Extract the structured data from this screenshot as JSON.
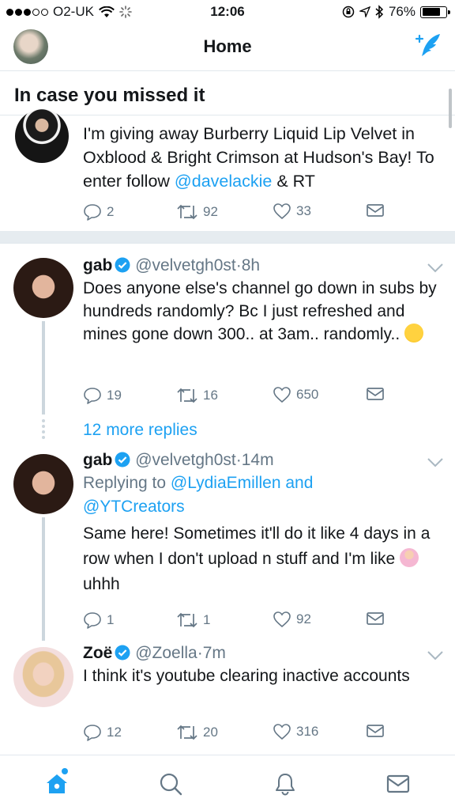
{
  "status_bar": {
    "carrier": "O2-UK",
    "time": "12:06",
    "battery": "76%",
    "battery_level": 0.76
  },
  "nav": {
    "title": "Home"
  },
  "section": {
    "title": "In case you missed it"
  },
  "tweets": [
    {
      "text_before": "I'm giving away Burberry Liquid Lip Velvet in Oxblood & Bright Crimson at Hudson's Bay! To enter follow ",
      "mention": "@davelackie",
      "text_after": " & RT",
      "replies": "2",
      "retweets": "92",
      "likes": "33"
    },
    {
      "name": "gab",
      "handle": "@velvetgh0st",
      "time": "8h",
      "text": "Does anyone else's channel go down in subs by hundreds randomly? Bc I just refreshed and mines gone down 300.. at 3am.. randomly..",
      "replies": "19",
      "retweets": "16",
      "likes": "650"
    },
    {
      "name": "gab",
      "handle": "@velvetgh0st",
      "time": "14m",
      "replying_label": "Replying to ",
      "replying_to_1": "@LydiaEmillen",
      "replying_and": " and",
      "replying_to_2": "@YTCreators",
      "text_before": "Same here! Sometimes it'll do it like 4 days in a row when I don't upload n stuff and I'm like ",
      "text_after": " uhhh",
      "replies": "1",
      "retweets": "1",
      "likes": "92"
    },
    {
      "name": "Zoë",
      "handle": "@Zoella",
      "time": "7m",
      "text": "I think it's youtube clearing inactive accounts",
      "replies": "12",
      "retweets": "20",
      "likes": "316"
    }
  ],
  "more_replies": "12 more replies",
  "separator_dot": "·",
  "colors": {
    "accent": "#1da1f2",
    "text": "#14171a",
    "secondary": "#657786",
    "border": "#e1e8ed"
  },
  "tabs": [
    "home-icon",
    "search-icon",
    "bell-icon",
    "mail-icon"
  ]
}
